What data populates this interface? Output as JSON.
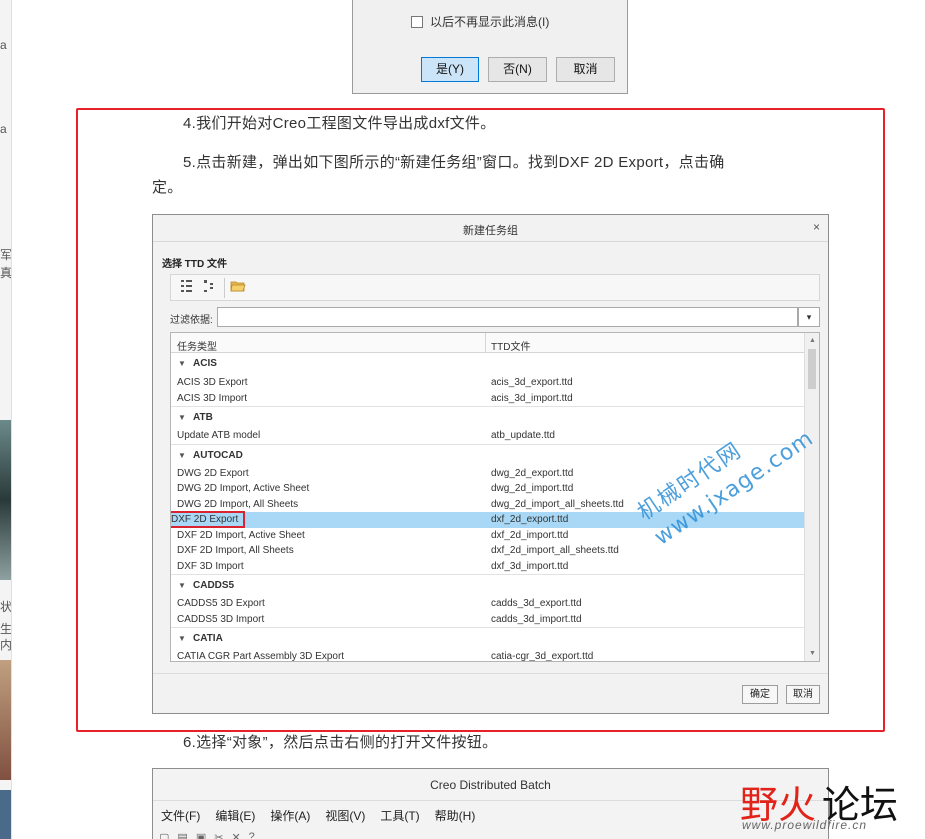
{
  "left_strip": {
    "fragments": [
      "a",
      "a",
      "军",
      "真",
      "状",
      "生",
      "内"
    ]
  },
  "top_dialog": {
    "checkbox_label": "以后不再显示此消息(I)",
    "yes_label": "是(Y)",
    "no_label": "否(N)",
    "cancel_label": "取消"
  },
  "article": {
    "step4": "4.我们开始对Creo工程图文件导出成dxf文件。",
    "step5_line1": "5.点击新建，弹出如下图所示的“新建任务组”窗口。找到DXF 2D Export，点击确",
    "step5_line2": "定。",
    "step6": "6.选择“对象”，然后点击右侧的打开文件按钮。"
  },
  "ttd_dialog": {
    "title": "新建任务组",
    "close_glyph": "×",
    "section_label": "选择 TTD 文件",
    "filter_label": "过滤依据:",
    "filter_value": "",
    "dropdown_glyph": "▾",
    "col_type": "任务类型",
    "col_file": "TTD文件",
    "groups": [
      {
        "name": "ACIS",
        "rows": [
          {
            "type": "ACIS 3D Export",
            "file": "acis_3d_export.ttd"
          },
          {
            "type": "ACIS 3D Import",
            "file": "acis_3d_import.ttd"
          }
        ]
      },
      {
        "name": "ATB",
        "rows": [
          {
            "type": "Update ATB model",
            "file": "atb_update.ttd"
          }
        ]
      },
      {
        "name": "AUTOCAD",
        "rows": [
          {
            "type": "DWG 2D Export",
            "file": "dwg_2d_export.ttd"
          },
          {
            "type": "DWG 2D Import, Active Sheet",
            "file": "dwg_2d_import.ttd"
          },
          {
            "type": "DWG 2D Import, All Sheets",
            "file": "dwg_2d_import_all_sheets.ttd"
          },
          {
            "type": "DXF 2D Export",
            "file": "dxf_2d_export.ttd",
            "selected": true
          },
          {
            "type": "DXF 2D Import, Active Sheet",
            "file": "dxf_2d_import.ttd"
          },
          {
            "type": "DXF 2D Import, All Sheets",
            "file": "dxf_2d_import_all_sheets.ttd"
          },
          {
            "type": "DXF 3D Import",
            "file": "dxf_3d_import.ttd"
          }
        ]
      },
      {
        "name": "CADDS5",
        "rows": [
          {
            "type": "CADDS5 3D Export",
            "file": "cadds_3d_export.ttd"
          },
          {
            "type": "CADDS5 3D Import",
            "file": "cadds_3d_import.ttd"
          }
        ]
      },
      {
        "name": "CATIA",
        "rows": [
          {
            "type": "CATIA CGR Part Assembly 3D Export",
            "file": "catia-cgr_3d_export.ttd"
          }
        ]
      }
    ],
    "ok_label": "确定",
    "cancel_label": "取消"
  },
  "watermark": {
    "line1": "机械时代网",
    "line2": "www.jxage.com"
  },
  "cdb_window": {
    "title": "Creo Distributed Batch",
    "menu": [
      "文件(F)",
      "编辑(E)",
      "操作(A)",
      "视图(V)",
      "工具(T)",
      "帮助(H)"
    ]
  },
  "logo": {
    "text_red": "野火",
    "text_black": "论坛",
    "url": "www.proewildfire.cn"
  },
  "colors": {
    "highlight_red": "#e8202a",
    "selection_blue": "#a8d8f5",
    "watermark_blue": "#2d8fd6"
  }
}
